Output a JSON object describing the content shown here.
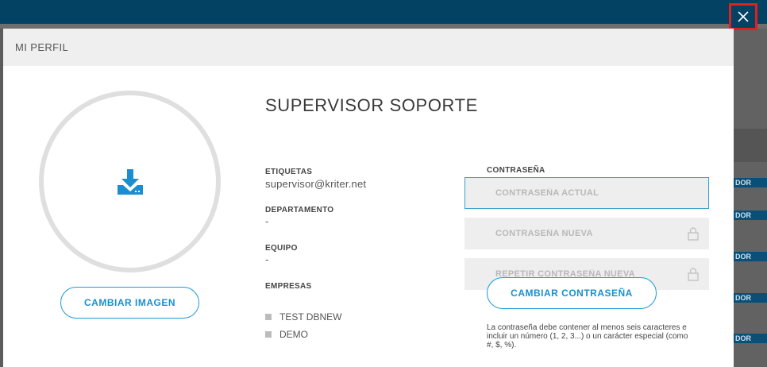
{
  "modal": {
    "title": "MI PERFIL",
    "close_icon": "close-icon"
  },
  "avatar": {
    "icon": "download-icon",
    "change_image_label": "CAMBIAR IMAGEN"
  },
  "user": {
    "name": "SUPERVISOR SOPORTE",
    "labels_title": "ETIQUETAS",
    "labels_value": "supervisor@kriter.net",
    "department_title": "DEPARTAMENTO",
    "department_value": "-",
    "team_title": "EQUIPO",
    "team_value": "-",
    "companies_title": "EMPRESAS",
    "companies": [
      "TEST DBNEW",
      "DEMO"
    ]
  },
  "password": {
    "title": "CONTRASEÑA",
    "current_placeholder": "CONTRASEÑA ACTUAL",
    "new_placeholder": "CONTRASEÑA NUEVA",
    "repeat_placeholder": "REPETIR CONTRASEÑA NUEVA",
    "change_label": "CAMBIAR CONTRASEÑA",
    "hint": "La contraseña debe contener al menos seis caracteres e incluir un número (1, 2, 3...) o un carácter especial (como #, $, %)."
  },
  "background": {
    "side_tag": "DOR"
  },
  "colors": {
    "accent": "#1a9ad8",
    "topbar": "#034263",
    "close_border": "#e0201f"
  }
}
